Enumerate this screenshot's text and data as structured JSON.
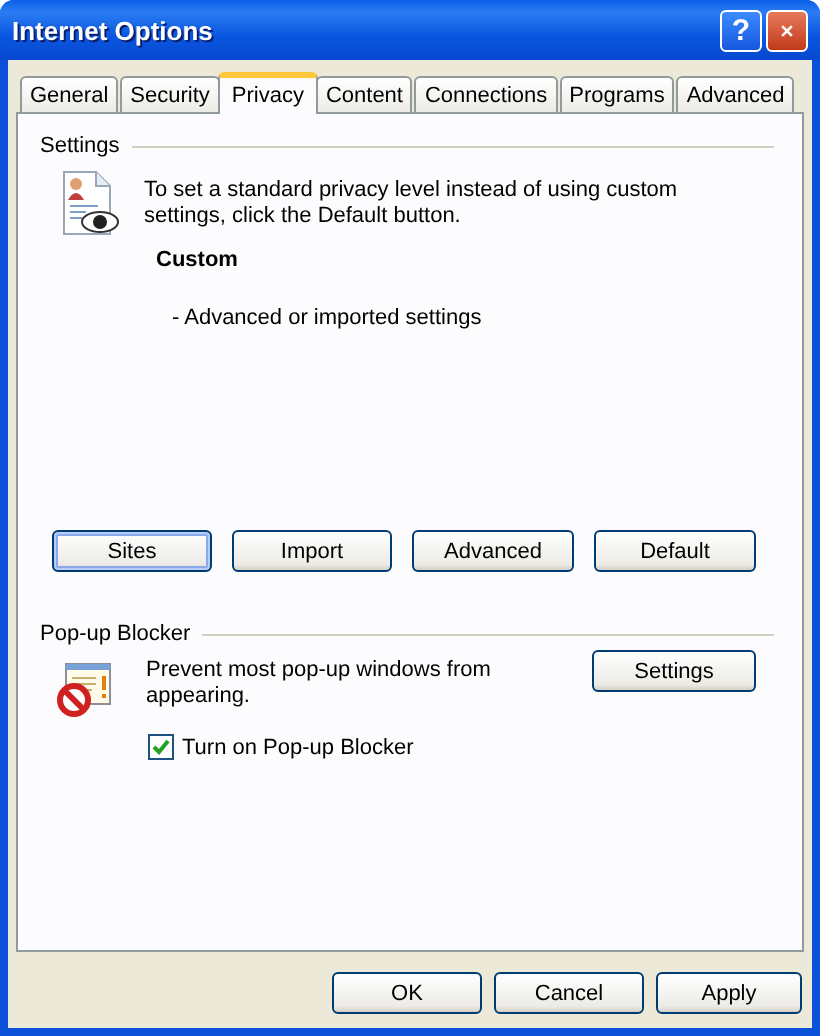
{
  "window": {
    "title": "Internet Options",
    "help": "?"
  },
  "tabs": [
    {
      "label": "General",
      "selected": false
    },
    {
      "label": "Security",
      "selected": false
    },
    {
      "label": "Privacy",
      "selected": true
    },
    {
      "label": "Content",
      "selected": false
    },
    {
      "label": "Connections",
      "selected": false
    },
    {
      "label": "Programs",
      "selected": false
    },
    {
      "label": "Advanced",
      "selected": false
    }
  ],
  "settings": {
    "title": "Settings",
    "description": "To set a standard privacy level instead of using custom settings, click the Default button.",
    "level": "Custom",
    "level_detail": "- Advanced or imported settings",
    "buttons": [
      {
        "label": "Sites",
        "focused": true
      },
      {
        "label": "Import",
        "focused": false
      },
      {
        "label": "Advanced",
        "focused": false
      },
      {
        "label": "Default",
        "focused": false
      }
    ]
  },
  "popup_blocker": {
    "title": "Pop-up Blocker",
    "description": "Prevent most pop-up windows from appearing.",
    "button": "Settings",
    "checkbox": {
      "label": "Turn on Pop-up Blocker",
      "checked": true
    }
  },
  "dialog_buttons": [
    "OK",
    "Cancel",
    "Apply"
  ]
}
